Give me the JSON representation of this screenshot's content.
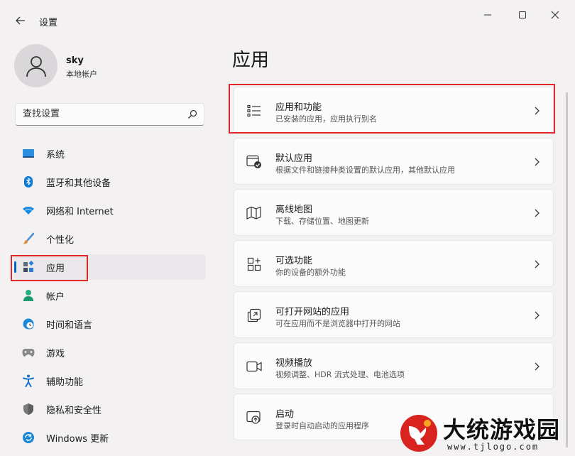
{
  "window": {
    "title": "设置"
  },
  "profile": {
    "name": "sky",
    "account_type": "本地帐户"
  },
  "search": {
    "placeholder": "查找设置"
  },
  "sidebar": {
    "items": [
      {
        "label": "系统",
        "icon": "monitor-icon",
        "color": "#0a7ad4"
      },
      {
        "label": "蓝牙和其他设备",
        "icon": "bluetooth-icon",
        "color": "#0a7ad4"
      },
      {
        "label": "网络和 Internet",
        "icon": "wifi-icon",
        "color": "#0a7ad4"
      },
      {
        "label": "个性化",
        "icon": "brush-icon",
        "color": "#c56a2c"
      },
      {
        "label": "应用",
        "icon": "apps-icon",
        "color": "#2f6fb3",
        "active": true
      },
      {
        "label": "帐户",
        "icon": "person-icon",
        "color": "#1fa37a"
      },
      {
        "label": "时间和语言",
        "icon": "globe-clock-icon",
        "color": "#0a7ad4"
      },
      {
        "label": "游戏",
        "icon": "gamepad-icon",
        "color": "#666666"
      },
      {
        "label": "辅助功能",
        "icon": "accessibility-icon",
        "color": "#1a73c9"
      },
      {
        "label": "隐私和安全性",
        "icon": "shield-icon",
        "color": "#6b6b6b"
      },
      {
        "label": "Windows 更新",
        "icon": "update-icon",
        "color": "#0a7ad4"
      }
    ]
  },
  "main": {
    "title": "应用",
    "cards": [
      {
        "title": "应用和功能",
        "subtitle": "已安装的应用，应用执行别名",
        "icon": "list-icon"
      },
      {
        "title": "默认应用",
        "subtitle": "根据文件和链接种类设置的默认应用，其他默认应用",
        "icon": "default-apps-icon"
      },
      {
        "title": "离线地图",
        "subtitle": "下载、存储位置、地图更新",
        "icon": "map-icon"
      },
      {
        "title": "可选功能",
        "subtitle": "你的设备的额外功能",
        "icon": "optional-features-icon"
      },
      {
        "title": "可打开网站的应用",
        "subtitle": "可在应用而不是浏览器中打开的网站",
        "icon": "open-in-app-icon"
      },
      {
        "title": "视频播放",
        "subtitle": "视频调整、HDR 流式处理、电池选项",
        "icon": "video-icon"
      },
      {
        "title": "启动",
        "subtitle": "登录时自动启动的应用程序",
        "icon": "startup-icon"
      }
    ]
  },
  "watermark": {
    "brand": "大统游戏园",
    "url": "www.tjlogo.com"
  },
  "colors": {
    "accent": "#0067c0",
    "highlight": "#e02a2a"
  }
}
